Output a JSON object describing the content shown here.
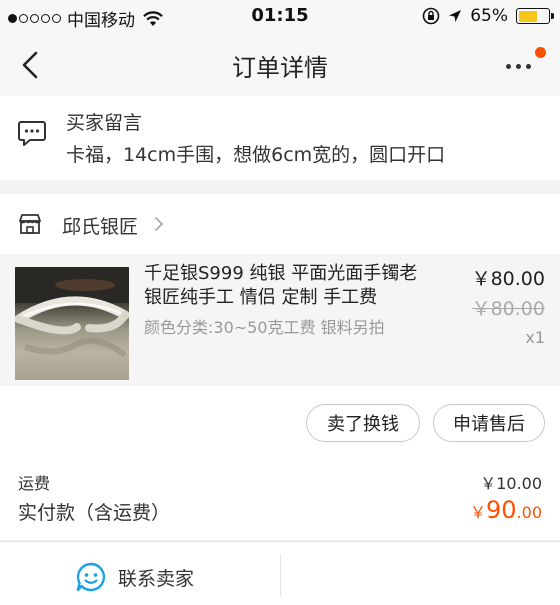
{
  "status_bar": {
    "carrier": "中国移动",
    "time": "01:15",
    "battery": "65%",
    "battery_level": 0.65,
    "signal_bars_filled": 1,
    "signal_bars_total": 5
  },
  "nav": {
    "title": "订单详情",
    "back_icon": "chevron-left-icon",
    "more_icon": "more-dots-icon"
  },
  "buyer_message": {
    "label": "买家留言",
    "text": "卡福，14cm手围，想做6cm宽的，圆口开口",
    "icon": "chat-bubble-icon"
  },
  "shop": {
    "name": "邱氏银匠",
    "icon": "store-icon"
  },
  "item": {
    "title": "千足银S999 纯银 平面光面手镯老银匠纯手工 情侣 定制 手工费",
    "spec": "颜色分类:30~50克工费 银料另拍",
    "price": "￥80.00",
    "original_price": "￥80.00",
    "quantity": "x1"
  },
  "actions": {
    "sell_label": "卖了换钱",
    "after_sale_label": "申请售后"
  },
  "payment": {
    "shipping_label": "运费",
    "shipping_value": "￥10.00",
    "paid_label": "实付款（含运费）",
    "paid_currency": "￥",
    "paid_integer": "90",
    "paid_decimal": ".00"
  },
  "bottom": {
    "contact_label": "联系卖家",
    "contact_icon": "smile-chat-icon"
  },
  "colors": {
    "accent": "#ff5000",
    "battery": "#f5c518",
    "link_blue": "#1ba1e6"
  }
}
